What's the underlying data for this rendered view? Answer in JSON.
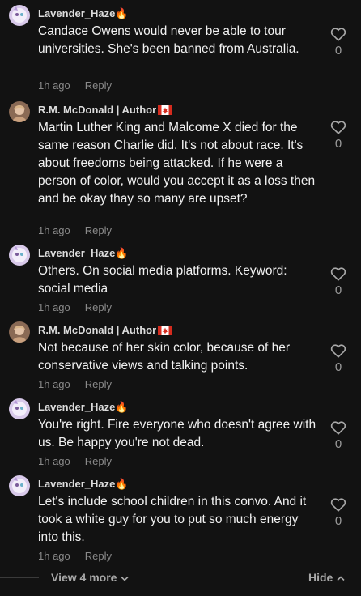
{
  "comments": [
    {
      "author": "Lavender_Haze🔥",
      "text": "Candace Owens would never be able to tour universities. She's been banned from Australia.",
      "time": "1h ago",
      "reply": "Reply",
      "likes": "0"
    },
    {
      "author": "R.M. McDonald | Author",
      "text": "Martin Luther King and Malcome X died for the same reason Charlie did. It's not about race. It's about freedoms being attacked. If he were a person of color, would you accept it as a loss then and be okay thay so many are upset?",
      "time": "1h ago",
      "reply": "Reply",
      "likes": "0"
    },
    {
      "author": "Lavender_Haze🔥",
      "text": "Others. On social media platforms. Keyword: social media",
      "time": "1h ago",
      "reply": "Reply",
      "likes": "0"
    },
    {
      "author": "R.M. McDonald | Author",
      "text": "Not because of her skin color, because of her conservative views and talking points.",
      "time": "1h ago",
      "reply": "Reply",
      "likes": "0"
    },
    {
      "author": "Lavender_Haze🔥",
      "text": "You're right. Fire everyone who doesn't agree with us. Be happy you're not dead.",
      "time": "1h ago",
      "reply": "Reply",
      "likes": "0"
    },
    {
      "author": "Lavender_Haze🔥",
      "text": "Let's include school children in this convo. And it took a white guy for you to put so much energy into this.",
      "time": "1h ago",
      "reply": "Reply",
      "likes": "0"
    }
  ],
  "footer": {
    "view_more": "View 4 more",
    "hide": "Hide"
  },
  "icons": {
    "like": "heart-outline-icon",
    "view_more": "chevron-down-icon",
    "hide": "chevron-up-icon",
    "flag": "canada-flag-icon"
  },
  "colors": {
    "background": "#121212",
    "text": "#f2f2f2",
    "muted": "#8a8a8a"
  }
}
